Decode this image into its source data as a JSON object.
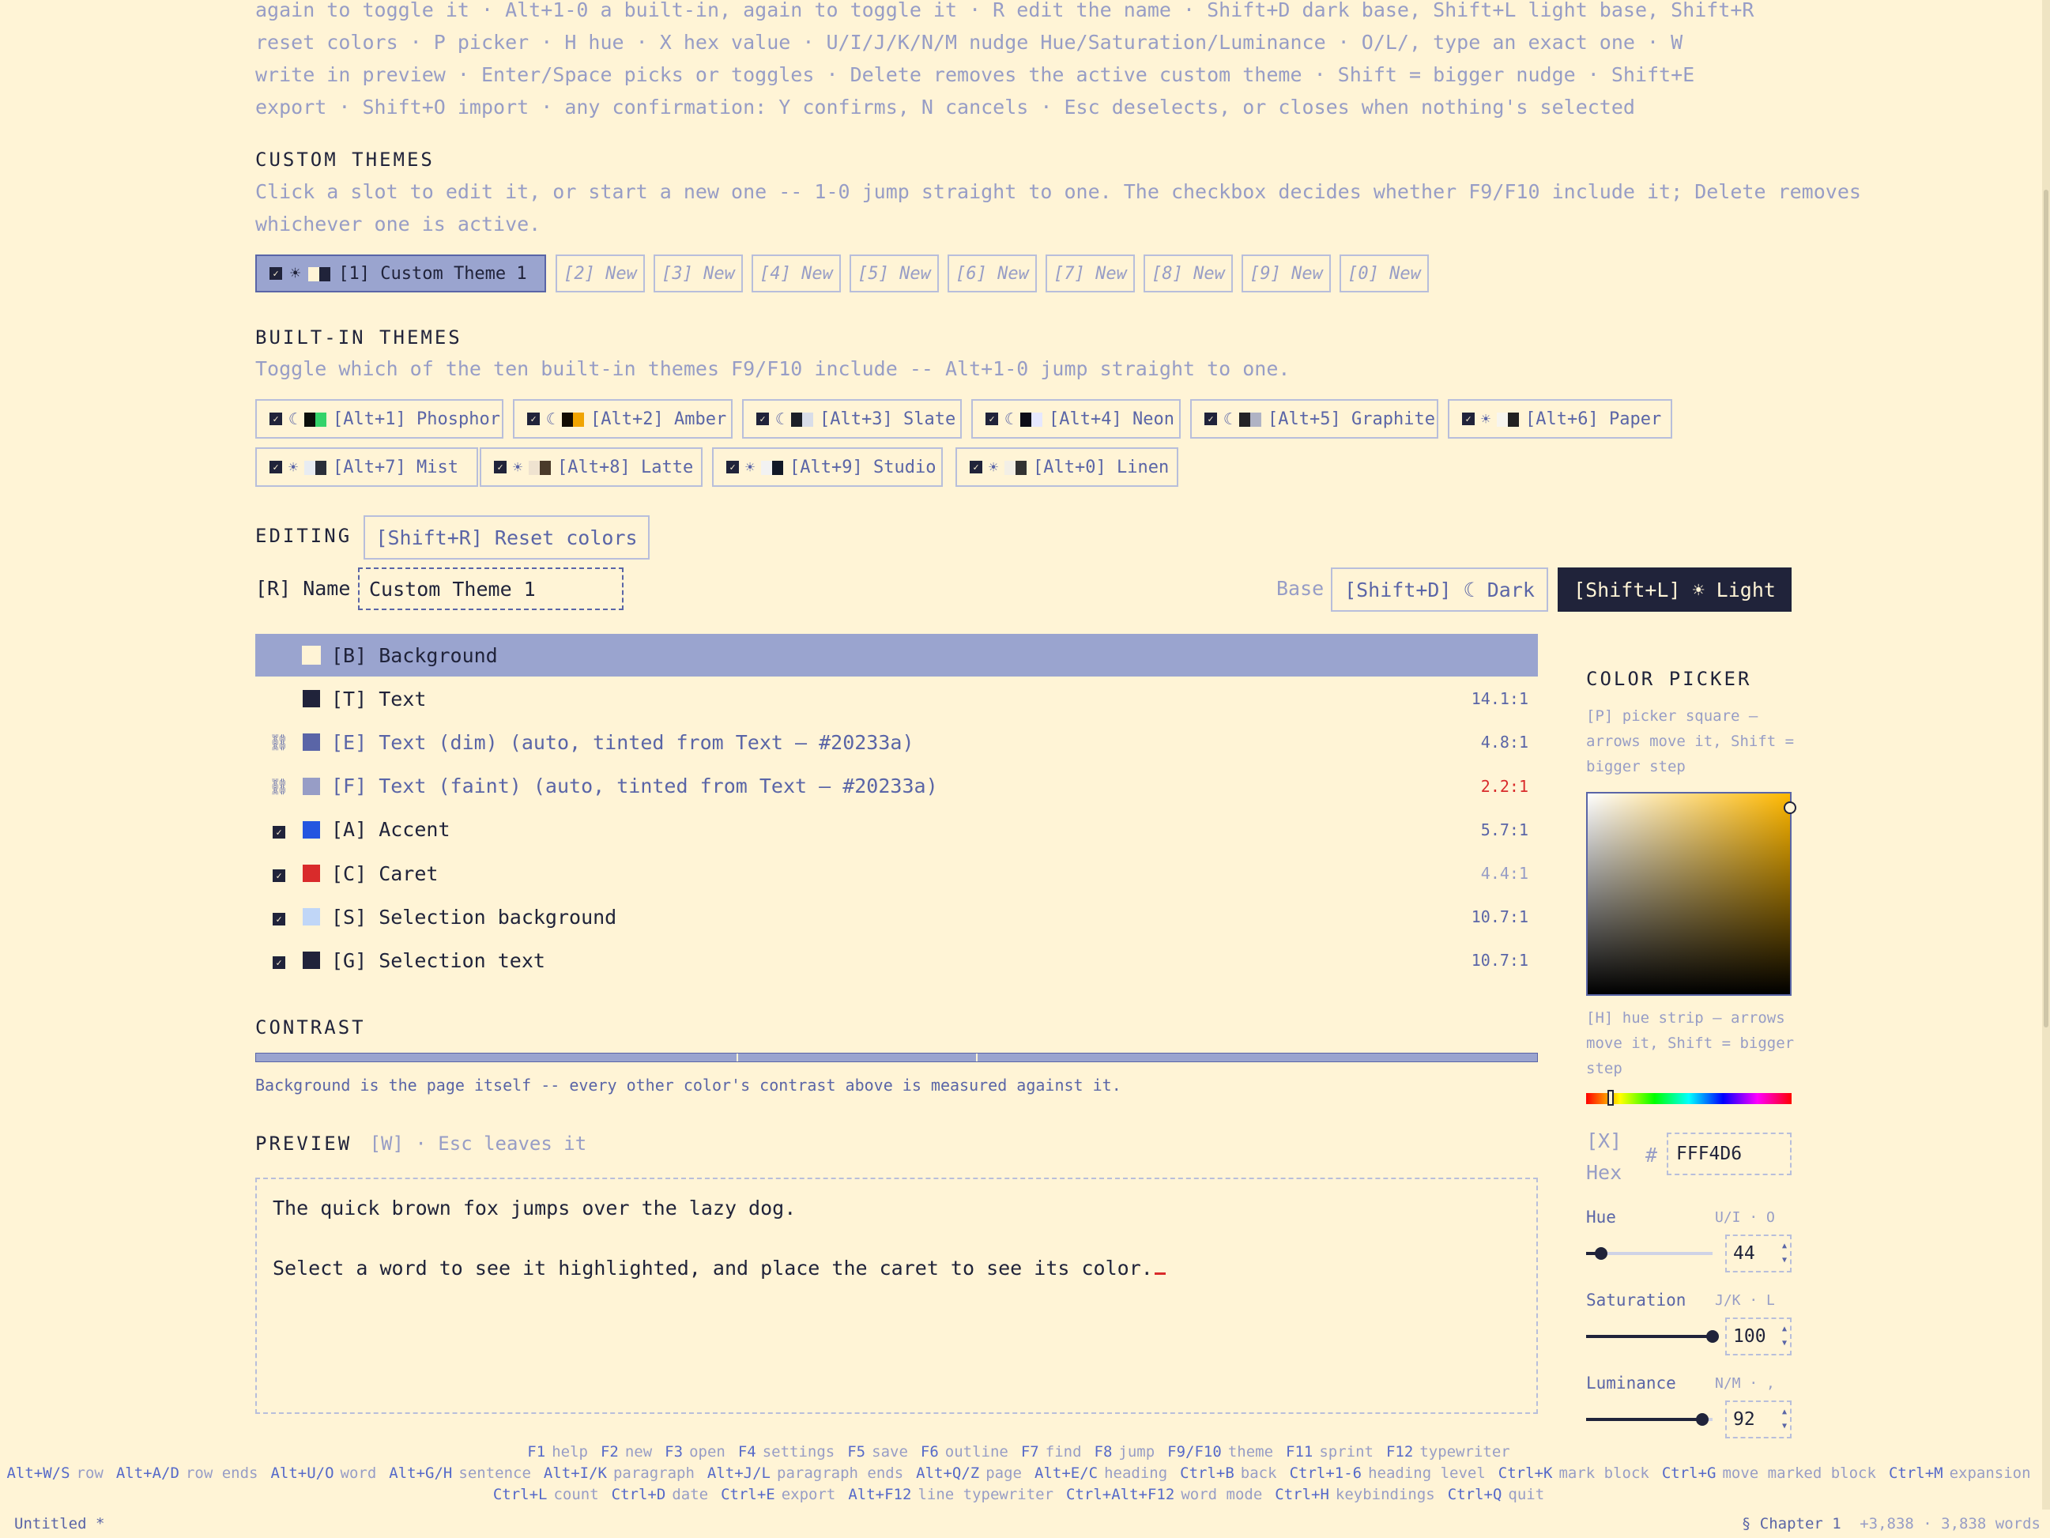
{
  "help_lines": [
    "again to toggle it  ·  Alt+1-0 a built-in, again to toggle it  ·  R edit the name  ·  Shift+D dark base, Shift+L light base, Shift+R",
    "reset colors  ·  P picker  ·  H hue  ·  X hex value  ·  U/I/J/K/N/M nudge Hue/Saturation/Luminance  ·  O/L/, type an exact one  ·  W",
    "write in preview  ·  Enter/Space picks or toggles  ·  Delete removes the active custom theme  ·  Shift = bigger nudge  ·  Shift+E",
    "export  ·  Shift+O import  ·  any confirmation: Y confirms, N cancels  ·  Esc deselects, or closes when nothing's selected"
  ],
  "custom_themes": {
    "title": "CUSTOM THEMES",
    "desc_line1": "Click a slot to edit it, or start a new one -- 1-0 jump straight to one. The checkbox decides whether F9/F10 include it; Delete removes",
    "desc_line2": "whichever one is active.",
    "active_slot": "[1] Custom Theme 1",
    "slots": [
      "[2] New",
      "[3] New",
      "[4] New",
      "[5] New",
      "[6] New",
      "[7] New",
      "[8] New",
      "[9] New",
      "[0] New"
    ]
  },
  "builtin_themes": {
    "title": "BUILT-IN THEMES",
    "desc": "Toggle which of the ten built-in themes F9/F10 include -- Alt+1-0 jump straight to one.",
    "items": [
      {
        "label": "[Alt+1] Phosphor",
        "mode": "☾",
        "c1": "#0b0f0b",
        "c2": "#33d36a"
      },
      {
        "label": "[Alt+2] Amber",
        "mode": "☾",
        "c1": "#120c02",
        "c2": "#f0a400"
      },
      {
        "label": "[Alt+3] Slate",
        "mode": "☾",
        "c1": "#1b1f27",
        "c2": "#d8dde8"
      },
      {
        "label": "[Alt+4] Neon",
        "mode": "☾",
        "c1": "#0d0d18",
        "c2": "#e6e8ff"
      },
      {
        "label": "[Alt+5] Graphite",
        "mode": "☾",
        "c1": "#232326",
        "c2": "#b0b3c4"
      },
      {
        "label": "[Alt+6] Paper",
        "mode": "☀",
        "c1": "#f7f5ee",
        "c2": "#222222"
      },
      {
        "label": "[Alt+7] Mist",
        "mode": "☀",
        "c1": "#e8ecf2",
        "c2": "#2a2f3a"
      },
      {
        "label": "[Alt+8] Latte",
        "mode": "☀",
        "c1": "#efe3d0",
        "c2": "#4a3a2a"
      },
      {
        "label": "[Alt+9] Studio",
        "mode": "☀",
        "c1": "#f2f2f2",
        "c2": "#111827"
      },
      {
        "label": "[Alt+0] Linen",
        "mode": "☀",
        "c1": "#f3efe6",
        "c2": "#333333"
      }
    ]
  },
  "editing": {
    "title": "EDITING",
    "reset_label": "[Shift+R] Reset colors",
    "name_label": "[R] Name",
    "name_value": "Custom Theme 1",
    "base_label": "Base",
    "dark_label": "[Shift+D] ☾ Dark",
    "light_label": "[Shift+L] ☀ Light"
  },
  "color_rows": [
    {
      "lead": "",
      "label": "[B] Background",
      "swatch": "#fff4d6",
      "ratio": "",
      "selected": true
    },
    {
      "lead": "",
      "label": "[T] Text",
      "swatch": "#20233a",
      "ratio": "14.1:1"
    },
    {
      "lead": "⛓",
      "label": "[E] Text (dim) (auto, tinted from Text — #20233a)",
      "swatch": "#5a65a7",
      "ratio": "4.8:1",
      "dim": true
    },
    {
      "lead": "⛓",
      "label": "[F] Text (faint) (auto, tinted from Text — #20233a)",
      "swatch": "#979dc6",
      "ratio": "2.2:1",
      "dim": true,
      "warn": true
    },
    {
      "lead": "✓",
      "label": "[A] Accent",
      "swatch": "#2456e0",
      "ratio": "5.7:1"
    },
    {
      "lead": "✓",
      "label": "[C] Caret",
      "swatch": "#d92b2b",
      "ratio": "4.4:1",
      "faintratio": true
    },
    {
      "lead": "✓",
      "label": "[S] Selection background",
      "swatch": "#c0d6f7",
      "ratio": "10.7:1"
    },
    {
      "lead": "✓",
      "label": "[G] Selection text",
      "swatch": "#20233a",
      "ratio": "10.7:1"
    }
  ],
  "contrast": {
    "title": "CONTRAST",
    "note": "Background is the page itself -- every other color's contrast above is measured against it."
  },
  "preview": {
    "title": "PREVIEW",
    "hint": "[W] · Esc leaves it",
    "line1": "The quick brown fox jumps over the lazy dog.",
    "line2": "Select a word to see it highlighted, and place the caret to see its color."
  },
  "picker": {
    "title": "COLOR PICKER",
    "square_hint": "[P] picker square — arrows move it, Shift = bigger step",
    "hue_hint": "[H] hue strip — arrows move it, Shift = bigger step",
    "hex_label_1": "[X]",
    "hex_label_2": "Hex",
    "hex_prefix": "#",
    "hex_value": "FFF4D6",
    "hue_label": "Hue",
    "hue_keys": "U/I  ·  O",
    "hue_value": "44",
    "sat_label": "Saturation",
    "sat_keys": "J/K  ·  L",
    "sat_value": "100",
    "lum_label": "Luminance",
    "lum_keys": "N/M  ·  ,",
    "lum_value": "92",
    "hue_level": 0.12,
    "sat_level": 1.0,
    "lum_level": 0.92
  },
  "keybar": {
    "row1": [
      [
        "F1",
        "help"
      ],
      [
        "F2",
        "new"
      ],
      [
        "F3",
        "open"
      ],
      [
        "F4",
        "settings"
      ],
      [
        "F5",
        "save"
      ],
      [
        "F6",
        "outline"
      ],
      [
        "F7",
        "find"
      ],
      [
        "F8",
        "jump"
      ],
      [
        "F9/F10",
        "theme"
      ],
      [
        "F11",
        "sprint"
      ],
      [
        "F12",
        "typewriter"
      ]
    ],
    "row2": [
      [
        "Alt+W/S",
        "row"
      ],
      [
        "Alt+A/D",
        "row ends"
      ],
      [
        "Alt+U/O",
        "word"
      ],
      [
        "Alt+G/H",
        "sentence"
      ],
      [
        "Alt+I/K",
        "paragraph"
      ],
      [
        "Alt+J/L",
        "paragraph ends"
      ],
      [
        "Alt+Q/Z",
        "page"
      ],
      [
        "Alt+E/C",
        "heading"
      ],
      [
        "Ctrl+B",
        "back"
      ],
      [
        "Ctrl+1-6",
        "heading level"
      ],
      [
        "Ctrl+K",
        "mark block"
      ],
      [
        "Ctrl+G",
        "move marked block"
      ],
      [
        "Ctrl+M",
        "expansion"
      ]
    ],
    "row3": [
      [
        "Ctrl+L",
        "count"
      ],
      [
        "Ctrl+D",
        "date"
      ],
      [
        "Ctrl+E",
        "export"
      ],
      [
        "Alt+F12",
        "line typewriter"
      ],
      [
        "Ctrl+Alt+F12",
        "word mode"
      ],
      [
        "Ctrl+H",
        "keybindings"
      ],
      [
        "Ctrl+Q",
        "quit"
      ]
    ]
  },
  "status": {
    "left": "Untitled *",
    "chapter": "§ Chapter 1",
    "counts": "+3,838 · 3,838 words"
  }
}
